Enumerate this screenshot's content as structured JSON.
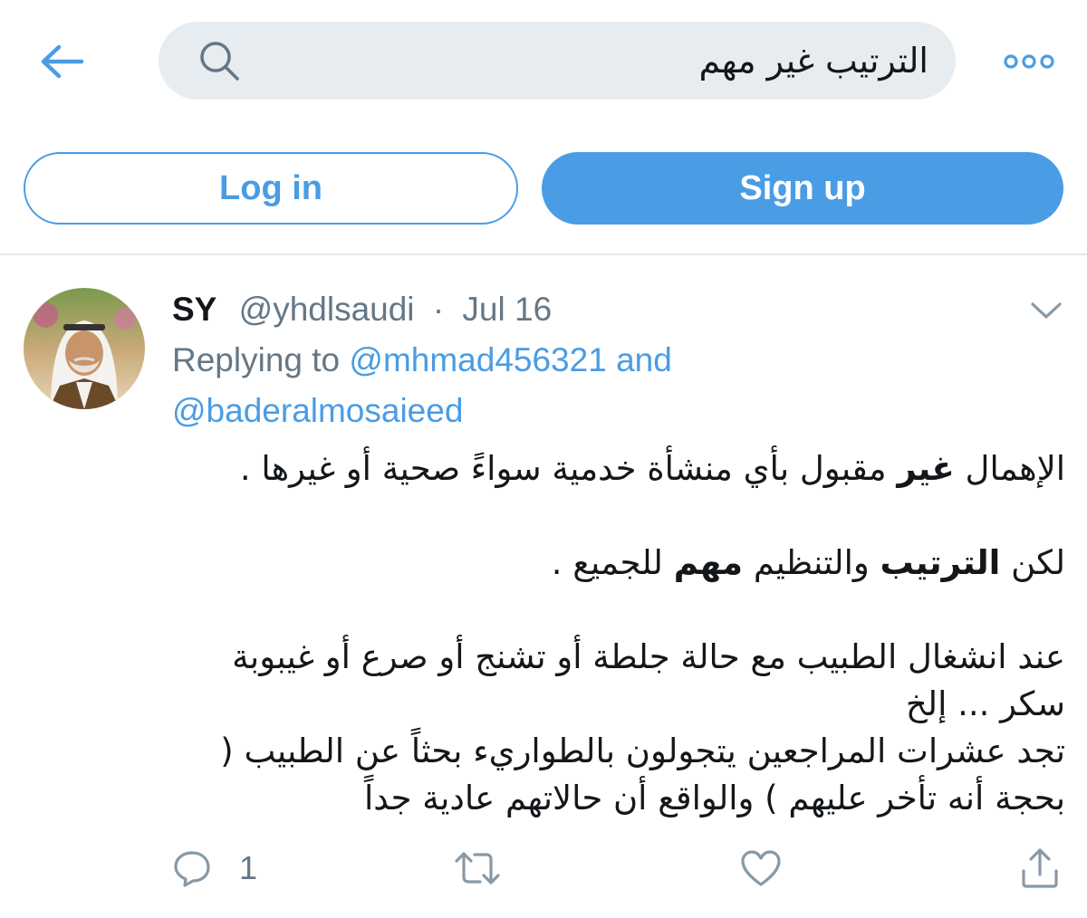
{
  "colors": {
    "accent": "#4a9ce4",
    "search_bg": "#e6ecf0",
    "text_primary": "#14171a",
    "text_secondary": "#657786",
    "divider": "#e1e8ed"
  },
  "topbar": {
    "back_icon": "arrow-left-icon",
    "search_icon": "search-icon",
    "search_query": "الترتيب غير مهم",
    "more_icon": "more-horizontal-icon"
  },
  "auth": {
    "login_label": "Log in",
    "signup_label": "Sign up"
  },
  "tweet": {
    "display_name": "SY",
    "handle": "@yhdlsaudi",
    "separator": "·",
    "date": "Jul 16",
    "replying_prefix": "Replying to",
    "mention_1": "@mhmad456321",
    "and_word": "and",
    "mention_2": "@baderalmosaieed",
    "body": {
      "p1_a": "الإهمال ",
      "p1_bold": "غير",
      "p1_b": " مقبول بأي منشأة خدمية سواءً صحية أو غيرها .",
      "p2_a": "لكن ",
      "p2_bold1": "الترتيب",
      "p2_b": " والتنظيم ",
      "p2_bold2": "مهم",
      "p2_c": " للجميع .",
      "p3_line1": "عند انشغال الطبيب مع حالة جلطة أو تشنج أو صرع أو غيبوبة",
      "p3_line2": "سكر ... إلخ",
      "p3_line3": "تجد عشرات المراجعين يتجولون بالطواريء بحثاً عن الطبيب (",
      "p3_line4": "بحجة أنه تأخر عليهم ) والواقع أن حالاتهم عادية جداً"
    },
    "actions": {
      "reply_icon": "reply-icon",
      "reply_count": "1",
      "retweet_icon": "retweet-icon",
      "like_icon": "heart-icon",
      "share_icon": "share-icon"
    }
  }
}
